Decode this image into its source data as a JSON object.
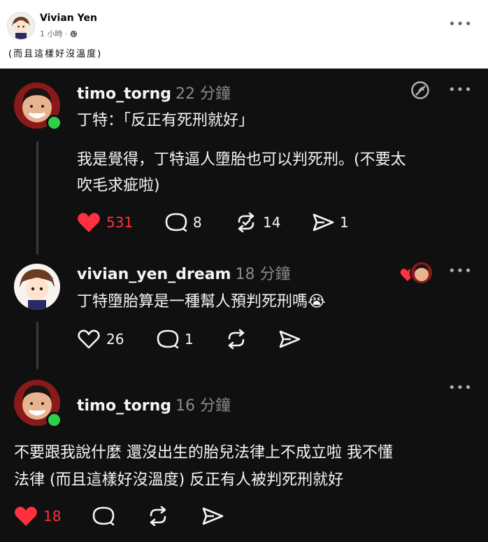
{
  "fb_post": {
    "author": "Vivian Yen",
    "time": "1 小時 ·",
    "privacy_icon": "globe-icon",
    "text": "(而且這樣好沒溫度)"
  },
  "threads": [
    {
      "username": "timo_torng",
      "time": "22 分鐘",
      "lines": [
        "丁特：「反正有死刑就好」",
        "我是覺得，丁特逼人墮胎也可以判死刑。(不要太",
        "吹毛求疵啦)"
      ],
      "likes": "531",
      "comments": "8",
      "reposts": "14",
      "shares": "1",
      "liked": true
    },
    {
      "username": "vivian_yen_dream",
      "time": "18 分鐘",
      "lines": [
        "丁特墮胎算是一種幫人預判死刑嗎😭"
      ],
      "likes": "26",
      "comments": "1",
      "liked": false
    },
    {
      "username": "timo_torng",
      "time": "16 分鐘",
      "lines": [
        "不要跟我說什麼 還沒出生的胎兒法律上不成立啦 我不懂",
        "法律 (而且這樣好沒溫度) 反正有人被判死刑就好"
      ],
      "likes": "18",
      "liked": true
    }
  ],
  "colors": {
    "like_red": "#ff3040",
    "online_green": "#2bd14d",
    "background": "#101010"
  }
}
